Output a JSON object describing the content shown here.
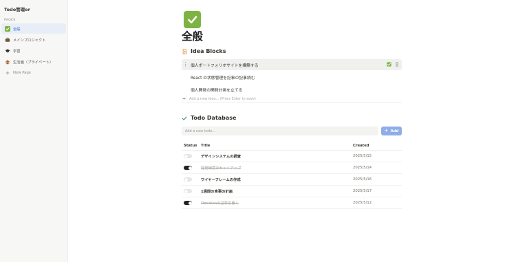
{
  "app": {
    "title": "Todo管理er"
  },
  "sidebar": {
    "section_label": "PAGES",
    "items": [
      {
        "label": "全般",
        "icon": "check-box-icon",
        "active": true
      },
      {
        "label": "メインプロジェクト",
        "icon": "briefcase-icon",
        "active": false
      },
      {
        "label": "学習",
        "icon": "graduation-cap-icon",
        "active": false
      },
      {
        "label": "生活面（プライベート）",
        "icon": "house-icon",
        "active": false
      }
    ],
    "new_page_label": "New Page"
  },
  "page": {
    "icon": "check-box-icon",
    "title": "全般"
  },
  "ideas": {
    "heading": "Idea Blocks",
    "items": [
      {
        "text": "個人ポートフォリオサイトを構築する"
      },
      {
        "text": "React の状態管理を記事の記事読む"
      },
      {
        "text": "個人開発の開発計画を立てる"
      }
    ],
    "add_placeholder": "Add a new idea... (Press Enter to save)"
  },
  "todos": {
    "heading": "Todo Database",
    "input_placeholder": "Add a new todo...",
    "add_label": "Add",
    "columns": {
      "status": "Status",
      "title": "Title",
      "created": "Created"
    },
    "rows": [
      {
        "title": "デザインシステムの調査",
        "created": "2025/5/15",
        "done": false
      },
      {
        "title": "開発環境のセットアップ",
        "created": "2025/5/14",
        "done": true
      },
      {
        "title": "ワイヤーフレームの作成",
        "created": "2025/5/16",
        "done": false
      },
      {
        "title": "1週間の食事の計画",
        "created": "2025/5/17",
        "done": false
      },
      {
        "title": "Obsidianの記事を書く",
        "created": "2025/5/12",
        "done": true
      }
    ]
  },
  "colors": {
    "accent": "#2e6fd1",
    "add_button": "#8faee8",
    "check_green": "#7cb342",
    "toggle_on": "#232323",
    "sidebar_bg": "#f7f7f5"
  }
}
